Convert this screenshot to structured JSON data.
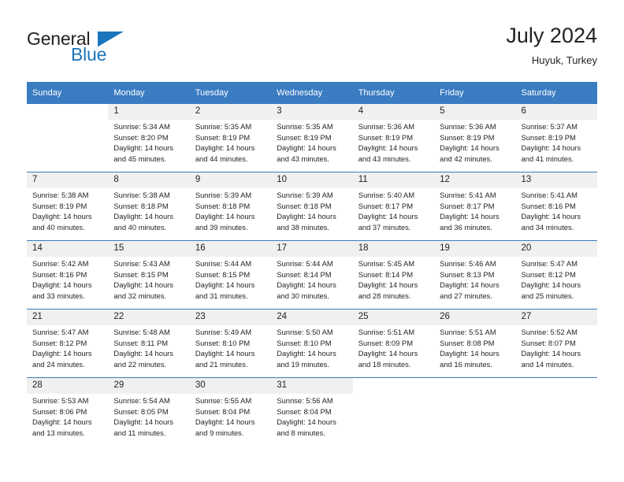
{
  "logo": {
    "word_one": "General",
    "word_two": "Blue",
    "triangle_icon": "blue-triangle-icon"
  },
  "header": {
    "title": "July 2024",
    "location": "Huyuk, Turkey"
  },
  "colors": {
    "header_blue": "#3a7cc2",
    "daynum_background": "#f0f0f0",
    "logo_blue": "#1b75bb",
    "text": "#231f20"
  },
  "calendar": {
    "weekday_headers": [
      "Sunday",
      "Monday",
      "Tuesday",
      "Wednesday",
      "Thursday",
      "Friday",
      "Saturday"
    ],
    "weeks": [
      [
        {
          "day": "",
          "lines": []
        },
        {
          "day": "1",
          "lines": [
            "Sunrise: 5:34 AM",
            "Sunset: 8:20 PM",
            "Daylight: 14 hours",
            "and 45 minutes."
          ]
        },
        {
          "day": "2",
          "lines": [
            "Sunrise: 5:35 AM",
            "Sunset: 8:19 PM",
            "Daylight: 14 hours",
            "and 44 minutes."
          ]
        },
        {
          "day": "3",
          "lines": [
            "Sunrise: 5:35 AM",
            "Sunset: 8:19 PM",
            "Daylight: 14 hours",
            "and 43 minutes."
          ]
        },
        {
          "day": "4",
          "lines": [
            "Sunrise: 5:36 AM",
            "Sunset: 8:19 PM",
            "Daylight: 14 hours",
            "and 43 minutes."
          ]
        },
        {
          "day": "5",
          "lines": [
            "Sunrise: 5:36 AM",
            "Sunset: 8:19 PM",
            "Daylight: 14 hours",
            "and 42 minutes."
          ]
        },
        {
          "day": "6",
          "lines": [
            "Sunrise: 5:37 AM",
            "Sunset: 8:19 PM",
            "Daylight: 14 hours",
            "and 41 minutes."
          ]
        }
      ],
      [
        {
          "day": "7",
          "lines": [
            "Sunrise: 5:38 AM",
            "Sunset: 8:19 PM",
            "Daylight: 14 hours",
            "and 40 minutes."
          ]
        },
        {
          "day": "8",
          "lines": [
            "Sunrise: 5:38 AM",
            "Sunset: 8:18 PM",
            "Daylight: 14 hours",
            "and 40 minutes."
          ]
        },
        {
          "day": "9",
          "lines": [
            "Sunrise: 5:39 AM",
            "Sunset: 8:18 PM",
            "Daylight: 14 hours",
            "and 39 minutes."
          ]
        },
        {
          "day": "10",
          "lines": [
            "Sunrise: 5:39 AM",
            "Sunset: 8:18 PM",
            "Daylight: 14 hours",
            "and 38 minutes."
          ]
        },
        {
          "day": "11",
          "lines": [
            "Sunrise: 5:40 AM",
            "Sunset: 8:17 PM",
            "Daylight: 14 hours",
            "and 37 minutes."
          ]
        },
        {
          "day": "12",
          "lines": [
            "Sunrise: 5:41 AM",
            "Sunset: 8:17 PM",
            "Daylight: 14 hours",
            "and 36 minutes."
          ]
        },
        {
          "day": "13",
          "lines": [
            "Sunrise: 5:41 AM",
            "Sunset: 8:16 PM",
            "Daylight: 14 hours",
            "and 34 minutes."
          ]
        }
      ],
      [
        {
          "day": "14",
          "lines": [
            "Sunrise: 5:42 AM",
            "Sunset: 8:16 PM",
            "Daylight: 14 hours",
            "and 33 minutes."
          ]
        },
        {
          "day": "15",
          "lines": [
            "Sunrise: 5:43 AM",
            "Sunset: 8:15 PM",
            "Daylight: 14 hours",
            "and 32 minutes."
          ]
        },
        {
          "day": "16",
          "lines": [
            "Sunrise: 5:44 AM",
            "Sunset: 8:15 PM",
            "Daylight: 14 hours",
            "and 31 minutes."
          ]
        },
        {
          "day": "17",
          "lines": [
            "Sunrise: 5:44 AM",
            "Sunset: 8:14 PM",
            "Daylight: 14 hours",
            "and 30 minutes."
          ]
        },
        {
          "day": "18",
          "lines": [
            "Sunrise: 5:45 AM",
            "Sunset: 8:14 PM",
            "Daylight: 14 hours",
            "and 28 minutes."
          ]
        },
        {
          "day": "19",
          "lines": [
            "Sunrise: 5:46 AM",
            "Sunset: 8:13 PM",
            "Daylight: 14 hours",
            "and 27 minutes."
          ]
        },
        {
          "day": "20",
          "lines": [
            "Sunrise: 5:47 AM",
            "Sunset: 8:12 PM",
            "Daylight: 14 hours",
            "and 25 minutes."
          ]
        }
      ],
      [
        {
          "day": "21",
          "lines": [
            "Sunrise: 5:47 AM",
            "Sunset: 8:12 PM",
            "Daylight: 14 hours",
            "and 24 minutes."
          ]
        },
        {
          "day": "22",
          "lines": [
            "Sunrise: 5:48 AM",
            "Sunset: 8:11 PM",
            "Daylight: 14 hours",
            "and 22 minutes."
          ]
        },
        {
          "day": "23",
          "lines": [
            "Sunrise: 5:49 AM",
            "Sunset: 8:10 PM",
            "Daylight: 14 hours",
            "and 21 minutes."
          ]
        },
        {
          "day": "24",
          "lines": [
            "Sunrise: 5:50 AM",
            "Sunset: 8:10 PM",
            "Daylight: 14 hours",
            "and 19 minutes."
          ]
        },
        {
          "day": "25",
          "lines": [
            "Sunrise: 5:51 AM",
            "Sunset: 8:09 PM",
            "Daylight: 14 hours",
            "and 18 minutes."
          ]
        },
        {
          "day": "26",
          "lines": [
            "Sunrise: 5:51 AM",
            "Sunset: 8:08 PM",
            "Daylight: 14 hours",
            "and 16 minutes."
          ]
        },
        {
          "day": "27",
          "lines": [
            "Sunrise: 5:52 AM",
            "Sunset: 8:07 PM",
            "Daylight: 14 hours",
            "and 14 minutes."
          ]
        }
      ],
      [
        {
          "day": "28",
          "lines": [
            "Sunrise: 5:53 AM",
            "Sunset: 8:06 PM",
            "Daylight: 14 hours",
            "and 13 minutes."
          ]
        },
        {
          "day": "29",
          "lines": [
            "Sunrise: 5:54 AM",
            "Sunset: 8:05 PM",
            "Daylight: 14 hours",
            "and 11 minutes."
          ]
        },
        {
          "day": "30",
          "lines": [
            "Sunrise: 5:55 AM",
            "Sunset: 8:04 PM",
            "Daylight: 14 hours",
            "and 9 minutes."
          ]
        },
        {
          "day": "31",
          "lines": [
            "Sunrise: 5:56 AM",
            "Sunset: 8:04 PM",
            "Daylight: 14 hours",
            "and 8 minutes."
          ]
        },
        {
          "day": "",
          "lines": []
        },
        {
          "day": "",
          "lines": []
        },
        {
          "day": "",
          "lines": []
        }
      ]
    ]
  }
}
